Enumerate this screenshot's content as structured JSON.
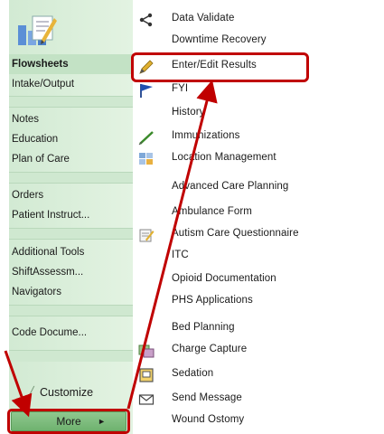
{
  "sidebar": {
    "items": [
      {
        "label": "Flowsheets",
        "active": true
      },
      {
        "label": "Intake/Output"
      },
      {
        "label": "Notes"
      },
      {
        "label": "Education"
      },
      {
        "label": "Plan of Care"
      },
      {
        "label": "Orders"
      },
      {
        "label": "Patient Instruct..."
      },
      {
        "label": "Additional Tools"
      },
      {
        "label": "ShiftAssessm..."
      },
      {
        "label": "Navigators"
      },
      {
        "label": "Code Docume..."
      }
    ],
    "customize_label": "Customize",
    "more_label": "More",
    "more_arrow": "►"
  },
  "menu": {
    "items": [
      {
        "label": "Data Validate",
        "icon": "share-nodes-icon"
      },
      {
        "label": "Downtime Recovery",
        "icon": ""
      },
      {
        "label": "Enter/Edit Results",
        "icon": "pencil-icon"
      },
      {
        "label": "FYI",
        "icon": "flag-icon"
      },
      {
        "label": "History",
        "icon": ""
      },
      {
        "label": "Immunizations",
        "icon": "syringe-icon"
      },
      {
        "label": "Location Management",
        "icon": "location-management-icon"
      },
      {
        "label": "Advanced Care Planning",
        "icon": ""
      },
      {
        "label": "Ambulance Form",
        "icon": ""
      },
      {
        "label": "Autism Care Questionnaire",
        "icon": "questionnaire-icon"
      },
      {
        "label": "ITC",
        "icon": ""
      },
      {
        "label": "Opioid Documentation",
        "icon": ""
      },
      {
        "label": "PHS Applications",
        "icon": ""
      },
      {
        "label": "Bed Planning",
        "icon": ""
      },
      {
        "label": "Charge Capture",
        "icon": "charge-capture-icon"
      },
      {
        "label": "Sedation",
        "icon": "sedation-icon"
      },
      {
        "label": "Send Message",
        "icon": "envelope-icon"
      },
      {
        "label": "Wound Ostomy",
        "icon": ""
      }
    ]
  },
  "annotations": {
    "highlight_color": "#c00000",
    "highlighted_menu_item": "Enter/Edit Results",
    "highlighted_button": "More"
  }
}
